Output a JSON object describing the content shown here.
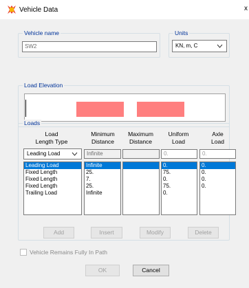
{
  "window": {
    "title": "Vehicle Data",
    "close_glyph": "x",
    "icon": "app-logo-icon"
  },
  "vehicle_name": {
    "label": "Vehicle name",
    "value": "SW2"
  },
  "units": {
    "label": "Units",
    "selected": "KN, m, C"
  },
  "load_elevation": {
    "label": "Load Elevation",
    "bar_color": "#ff7f7f"
  },
  "loads": {
    "label": "Loads",
    "headers": {
      "type": [
        "Load",
        "Length Type"
      ],
      "min": [
        "Minimum",
        "Distance"
      ],
      "max": [
        "Maximum",
        "Distance"
      ],
      "uniform": [
        "Uniform",
        "Load"
      ],
      "axle": [
        "Axle",
        "Load"
      ]
    },
    "input_row": {
      "type": "Leading Load",
      "min": "Infinite",
      "max": "",
      "uniform": "0.",
      "axle": "0."
    },
    "rows": [
      {
        "type": "Leading Load",
        "min": "Infinite",
        "max": "",
        "uniform": "0.",
        "axle": "0."
      },
      {
        "type": "Fixed Length",
        "min": "25.",
        "max": "",
        "uniform": "75.",
        "axle": "0."
      },
      {
        "type": "Fixed Length",
        "min": "7.",
        "max": "",
        "uniform": "0.",
        "axle": "0."
      },
      {
        "type": "Fixed Length",
        "min": "25.",
        "max": "",
        "uniform": "75.",
        "axle": "0."
      },
      {
        "type": "Trailing Load",
        "min": "Infinite",
        "max": "",
        "uniform": "0.",
        "axle": ""
      }
    ],
    "selected_row": 0,
    "buttons": {
      "add": "Add",
      "insert": "Insert",
      "modify": "Modify",
      "delete": "Delete"
    }
  },
  "remains_in_path": {
    "label": "Vehicle Remains Fully In Path",
    "checked": false
  },
  "dialog_buttons": {
    "ok": "OK",
    "cancel": "Cancel"
  },
  "colors": {
    "selection": "#0078d7",
    "group_label": "#003399"
  }
}
